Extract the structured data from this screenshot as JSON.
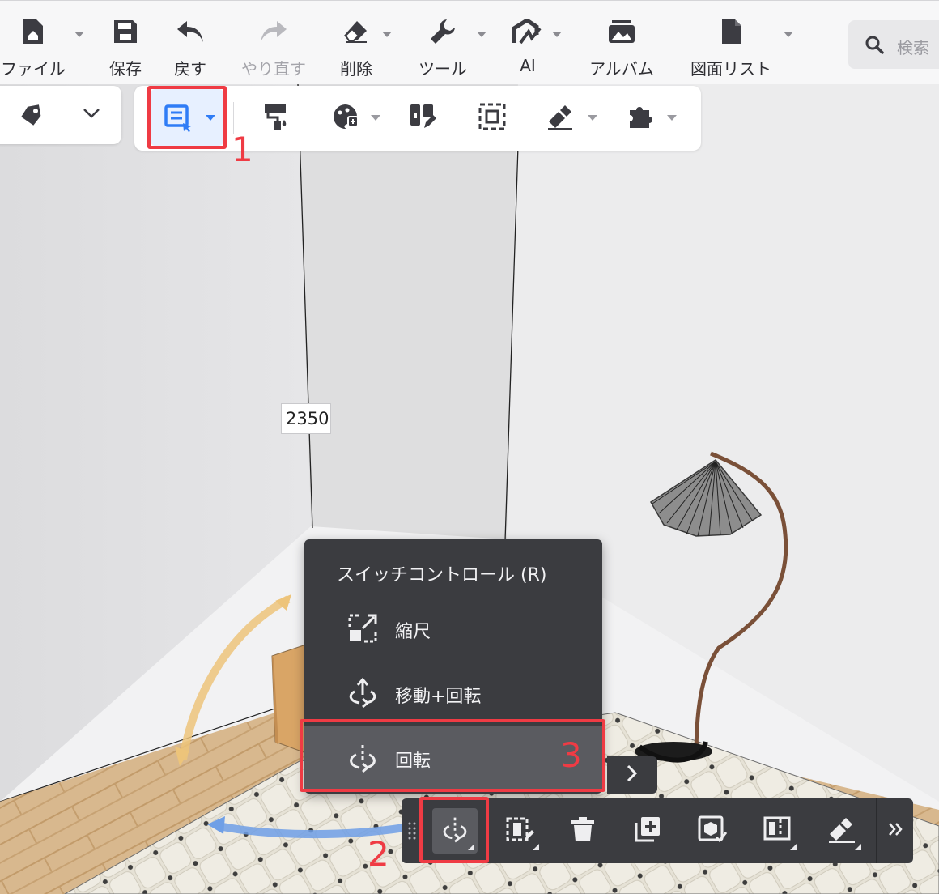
{
  "menubar": {
    "items": [
      {
        "label": "ファイル",
        "icon": "file-icon",
        "has_dropdown": true
      },
      {
        "label": "保存",
        "icon": "save-icon",
        "has_dropdown": false
      },
      {
        "label": "戻す",
        "icon": "undo-icon",
        "has_dropdown": false
      },
      {
        "label": "やり直す",
        "icon": "redo-icon",
        "has_dropdown": false,
        "disabled": true
      },
      {
        "label": "削除",
        "icon": "eraser-icon",
        "has_dropdown": true
      },
      {
        "label": "ツール",
        "icon": "wrench-icon",
        "has_dropdown": true
      },
      {
        "label": "AI",
        "icon": "ai-icon",
        "has_dropdown": true
      },
      {
        "label": "アルバム",
        "icon": "album-icon",
        "has_dropdown": false
      },
      {
        "label": "図面リスト",
        "icon": "drawing-list-icon",
        "has_dropdown": true
      }
    ],
    "search": {
      "placeholder": "検索",
      "icon": "search-icon"
    }
  },
  "toolbar": {
    "tag_panel": {
      "icons": [
        "tag-icon",
        "chevron-down-icon"
      ]
    },
    "tools": [
      {
        "icon": "select-mode-icon",
        "has_dropdown": true,
        "active": true
      },
      {
        "icon": "paint-roller-icon",
        "has_dropdown": false
      },
      {
        "icon": "material-palette-icon",
        "has_dropdown": true
      },
      {
        "icon": "edit-panel-icon",
        "has_dropdown": false
      },
      {
        "icon": "frame-select-icon",
        "has_dropdown": false
      },
      {
        "icon": "measure-hammer-icon",
        "has_dropdown": true
      },
      {
        "icon": "plugin-puzzle-icon",
        "has_dropdown": true
      }
    ]
  },
  "viewport": {
    "dimension_label": "2350"
  },
  "switch_menu": {
    "title": "スイッチコントロール (R)",
    "items": [
      {
        "label": "縮尺",
        "icon": "scale-icon"
      },
      {
        "label": "移動+回転",
        "icon": "move-rotate-icon"
      },
      {
        "label": "回転",
        "icon": "rotate-icon",
        "selected": true
      }
    ]
  },
  "bottom_toolbar": {
    "tools": [
      "rotate-icon",
      "replace-icon",
      "trash-icon",
      "duplicate-icon",
      "group-icon",
      "align-icon",
      "hammer-icon"
    ],
    "more_icon": "double-chevron-right-icon"
  },
  "annotations": {
    "labels": [
      "1",
      "2",
      "3"
    ],
    "color": "#ef3b44"
  },
  "colors": {
    "accent": "#2f7cf6",
    "dark_panel": "#3b3c40",
    "highlight": "#5a5b60"
  }
}
